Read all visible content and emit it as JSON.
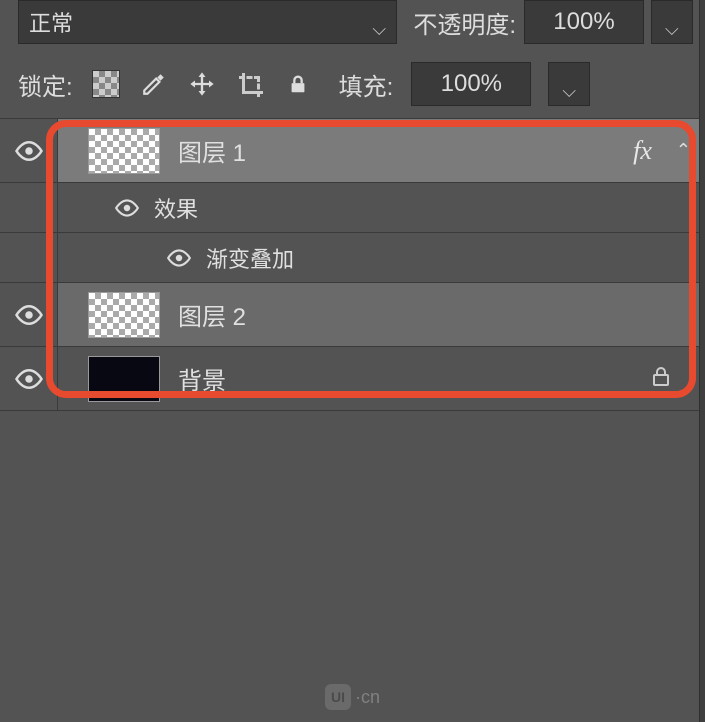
{
  "top": {
    "blend_mode": "正常",
    "opacity_label": "不透明度:",
    "opacity_value": "100%"
  },
  "lock": {
    "label": "锁定:",
    "fill_label": "填充:",
    "fill_value": "100%"
  },
  "layers": {
    "layer1": {
      "name": "图层 1",
      "fx": "fx"
    },
    "effects_label": "效果",
    "gradient_overlay": "渐变叠加",
    "layer2": {
      "name": "图层 2"
    },
    "background": {
      "name": "背景"
    }
  },
  "watermark": "·cn"
}
